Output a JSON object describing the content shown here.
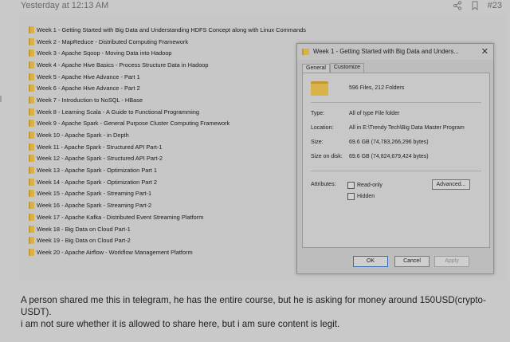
{
  "post": {
    "timestamp": "Yesterday at 12:13 AM",
    "post_number": "#23",
    "message_lines": [
      "A person shared me this in telegram, he has the entire course, but he is asking for money around 150USD(crypto-",
      "USDT).",
      "i am not sure whether it is allowed to share here, but i am sure content is legit."
    ]
  },
  "folders": [
    "Week 1 - Getting Started with Big Data and Understanding HDFS Concept along with Linux Commands",
    "Week 2 - MapReduce - Distributed Computing Framework",
    "Week 3 - Apache Sqoop - Moving Data into Hadoop",
    "Week 4 - Apache Hive Basics - Process Structure Data in Hadoop",
    "Week 5 - Apache Hive Advance - Part 1",
    "Week 6 - Apache Hive Advance - Part 2",
    "Week 7 - Introduction to NoSQL - HBase",
    "Week 8 - Learning Scala - A Guide to Functional Programming",
    "Week 9 - Apache Spark - General Purpose Cluster Computing Framework",
    "Week 10 - Apache Spark - in Depth",
    "Week 11 - Apache Spark - Structured API Part-1",
    "Week 12 - Apache Spark - Structured API Part-2",
    "Week 13 - Apache Spark - Optimization Part 1",
    "Week 14 - Apache Spark - Optimization Part 2",
    "Week 15 - Apache Spark - Streaming Part-1",
    "Week 16 - Apache Spark - Streaming Part-2",
    "Week 17 - Apache Kafka - Distributed Event Streaming Platform",
    "Week 18 - Big Data on Cloud Part-1",
    "Week 19 - Big Data on Cloud Part-2",
    "Week 20 - Apache Airflow - Workflow Management Platform"
  ],
  "dialog": {
    "title": "Week 1 - Getting Started with Big Data and Unders...",
    "close_glyph": "✕",
    "tabs": [
      "General",
      "Customize"
    ],
    "file_count": "596 Files, 212 Folders",
    "type_label": "Type:",
    "type_value": "All of type File folder",
    "location_label": "Location:",
    "location_value": "All in E:\\Trendy Tech\\Big Data Master Program",
    "size_label": "Size:",
    "size_value": "69.6 GB (74,783,266,296 bytes)",
    "size_on_disk_label": "Size on disk:",
    "size_on_disk_value": "69.6 GB (74,824,679,424 bytes)",
    "attributes_label": "Attributes:",
    "readonly_label": "Read-only",
    "hidden_label": "Hidden",
    "advanced_label": "Advanced...",
    "ok_label": "OK",
    "cancel_label": "Cancel",
    "apply_label": "Apply"
  },
  "icons": {
    "share": "share-icon",
    "bookmark": "bookmark-icon",
    "folder": "folder-icon"
  },
  "colors": {
    "folder": "#d9b24a",
    "background": "#c9c9c9"
  }
}
